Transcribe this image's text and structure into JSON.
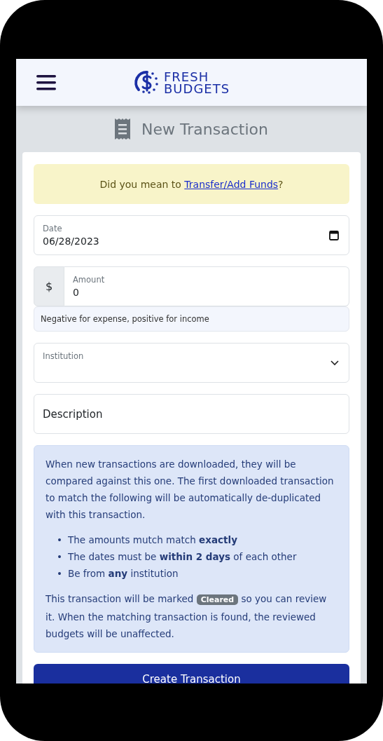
{
  "header": {
    "logo_line_1": "FRESH",
    "logo_line_2": "BUDGETS"
  },
  "page_title": "New Transaction",
  "alert": {
    "text_before": "Did you mean to ",
    "link": "Transfer/Add Funds",
    "text_after": "?"
  },
  "fields": [
    {
      "kind": "date",
      "label": "Date",
      "value": "06/28/2023"
    },
    {
      "kind": "amount",
      "prefix": "$",
      "label": "Amount",
      "value": "0",
      "help": "Negative for expense, positive for income"
    },
    {
      "kind": "select",
      "label": "Institution"
    },
    {
      "kind": "text",
      "placeholder": "Description"
    }
  ],
  "info": {
    "intro": "When new transactions are downloaded, they will be compared against this one. The first downloaded transaction to match the following will be automatically de-duplicated with this transaction.",
    "bullets": [
      {
        "marker": "•",
        "text": "The amounts mutch match **exactly**"
      },
      {
        "marker": "•",
        "text": "The dates must be **within 2 days** of each other"
      },
      {
        "marker": "•",
        "text": "Be from **any** institution"
      }
    ],
    "outro_before": "This transaction will be marked",
    "badge": "Cleared",
    "outro_after": "so you can review it. When the matching transaction is found, the reviewed budgets will be unaffected."
  },
  "submit_button": "Create Transaction"
}
